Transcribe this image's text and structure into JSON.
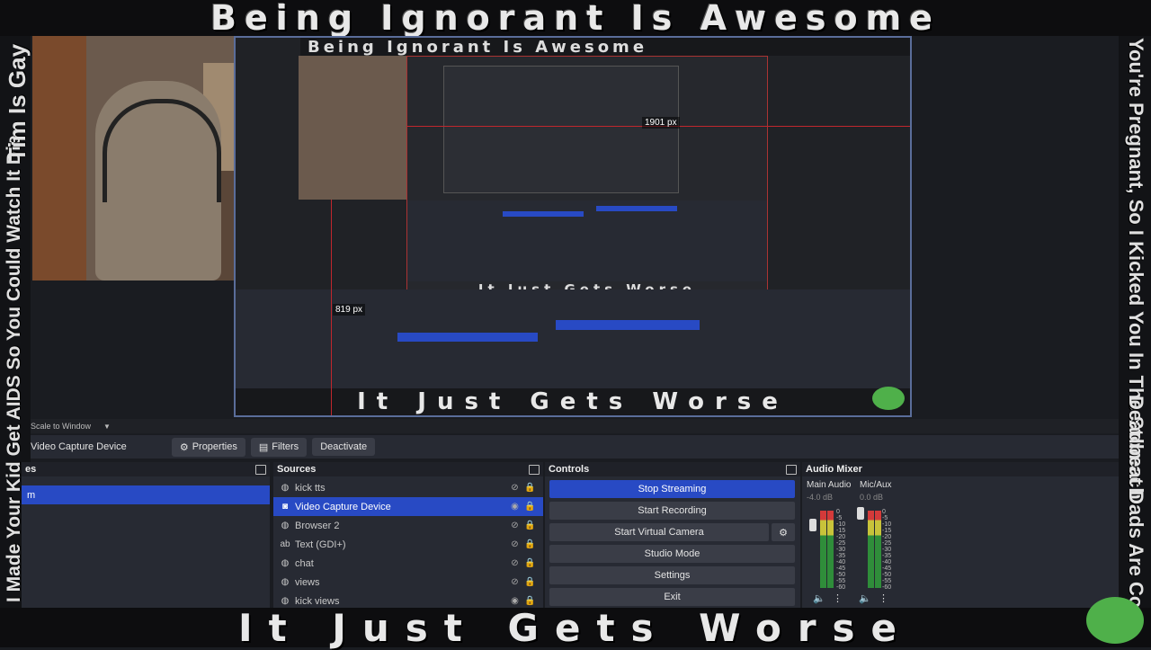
{
  "overlay": {
    "top_banner": "Being Ignorant Is Awesome",
    "bottom_banner": "It Just Gets Worse",
    "left_vertical_1": "I Made Your Kid Get AIDS So You Could Watch It Die",
    "left_vertical_2": "Tim Is Gay",
    "right_vertical_1": "You're Pregnant, So I Kicked You In The Stomach",
    "right_vertical_2": "Deadbeat Dads Are Cool",
    "px_label_1": "1901 px",
    "px_label_2": "819 px"
  },
  "scale": {
    "label": "Scale to Window"
  },
  "toolbar": {
    "source_name": "Video Capture Device",
    "properties_label": "Properties",
    "filters_label": "Filters",
    "deactivate_label": "Deactivate"
  },
  "scenes": {
    "title": "es",
    "selected_item": "m"
  },
  "sources": {
    "title": "Sources",
    "items": [
      {
        "name": "kick tts",
        "icon": "globe-icon",
        "visible": false,
        "locked": true,
        "selected": false
      },
      {
        "name": "Video Capture Device",
        "icon": "camera-icon",
        "visible": true,
        "locked": true,
        "selected": true
      },
      {
        "name": "Browser 2",
        "icon": "globe-icon",
        "visible": false,
        "locked": true,
        "selected": false
      },
      {
        "name": "Text (GDI+)",
        "icon": "text-icon",
        "visible": false,
        "locked": true,
        "selected": false
      },
      {
        "name": "chat",
        "icon": "globe-icon",
        "visible": false,
        "locked": true,
        "selected": false
      },
      {
        "name": "views",
        "icon": "globe-icon",
        "visible": false,
        "locked": true,
        "selected": false
      },
      {
        "name": "kick views",
        "icon": "globe-icon",
        "visible": true,
        "locked": true,
        "selected": false
      }
    ]
  },
  "controls": {
    "title": "Controls",
    "stop_streaming": "Stop Streaming",
    "start_recording": "Start Recording",
    "start_virtual_camera": "Start Virtual Camera",
    "studio_mode": "Studio Mode",
    "settings": "Settings",
    "exit": "Exit"
  },
  "mixer": {
    "title": "Audio Mixer",
    "channels": [
      {
        "name": "Main Audio",
        "db": "-4.0 dB"
      },
      {
        "name": "Mic/Aux",
        "db": "0.0 dB"
      }
    ],
    "ticks": [
      "0",
      "-5",
      "-10",
      "-15",
      "-20",
      "-25",
      "-30",
      "-35",
      "-40",
      "-45",
      "-50",
      "-55",
      "-60"
    ]
  },
  "colors": {
    "accent": "#284ac4",
    "guide": "#c0272d",
    "panel": "#272a33"
  }
}
